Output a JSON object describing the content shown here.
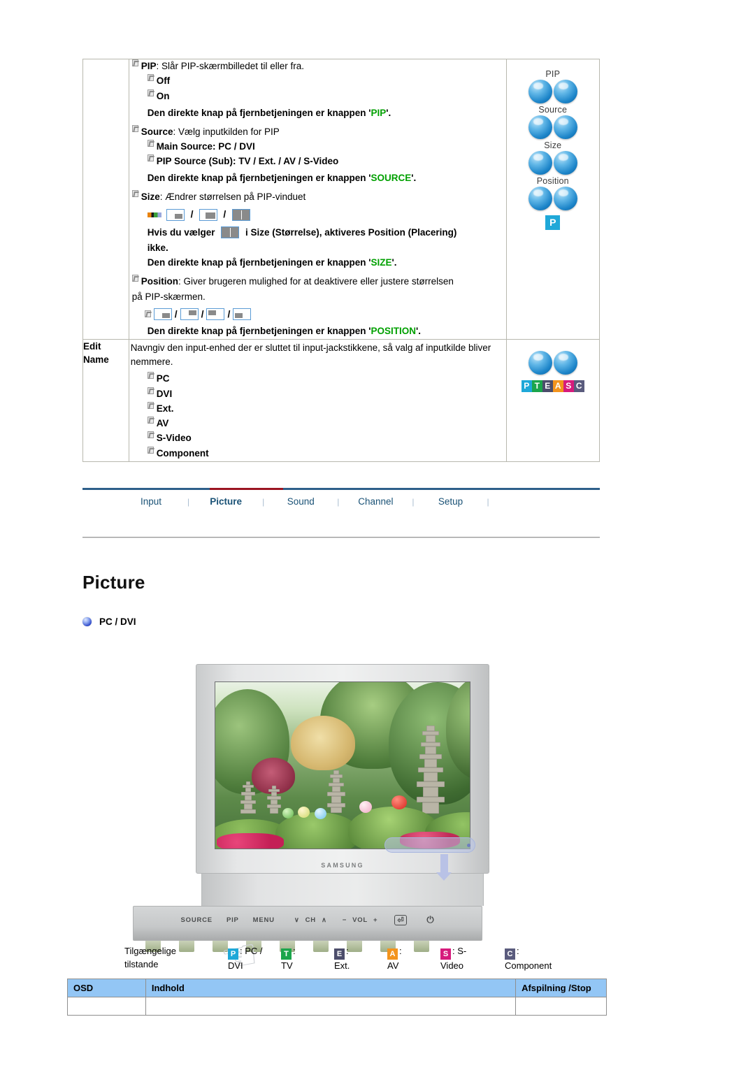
{
  "spec_table": {
    "rows": [
      {
        "label": "",
        "items": [
          {
            "title": "PIP",
            "desc": ": Slår PIP-skærmbilledet til eller fra.",
            "subs": [
              "Off",
              "On"
            ],
            "note_prefix": "Den direkte knap på fjernbetjeningen er knappen '",
            "note_key": "PIP",
            "note_suffix": "'."
          },
          {
            "title": "Source",
            "desc": ": Vælg inputkilden for PIP",
            "subs": [
              "Main Source: PC / DVI",
              "PIP Source (Sub): TV / Ext. / AV / S-Video"
            ],
            "note_prefix": "Den direkte knap på fjernbetjeningen er knappen '",
            "note_key": "SOURCE",
            "note_suffix": "'."
          },
          {
            "title": "Size",
            "desc": ": Ændrer størrelsen på PIP-vinduet",
            "icons_caption": "size-icons",
            "hint_a": "Hvis du vælger",
            "hint_b": "i Size (Størrelse), aktiveres Position (Placering)",
            "hint_c": "ikke.",
            "note_prefix": "Den direkte knap på fjernbetjeningen er knappen '",
            "note_key": "SIZE",
            "note_suffix": "'."
          },
          {
            "title": "Position",
            "desc": ": Giver brugeren mulighed for at deaktivere eller justere størrelsen",
            "desc2": "på PIP-skærmen.",
            "icons_caption": "position-icons",
            "note_prefix": "Den direkte knap på fjernbetjeningen er knappen '",
            "note_key": "POSITION",
            "note_suffix": "'."
          }
        ],
        "icon_column": {
          "groups": [
            {
              "caption": "PIP"
            },
            {
              "caption": "Source"
            },
            {
              "caption": "Size"
            },
            {
              "caption": "Position"
            }
          ],
          "badge": "P"
        }
      },
      {
        "label": "Edit\nName",
        "desc": "Navngiv den input-enhed der er sluttet til input-jackstikkene, så valg af inputkilde bliver nemmere.",
        "subs": [
          "PC",
          "DVI",
          "Ext.",
          "AV",
          "S-Video",
          "Component"
        ],
        "mode_strip": [
          {
            "letter": "P",
            "color": "#1fa8d8"
          },
          {
            "letter": "T",
            "color": "#1ba54b"
          },
          {
            "letter": "E",
            "color": "#4c4d6b"
          },
          {
            "letter": "A",
            "color": "#f3941d"
          },
          {
            "letter": "S",
            "color": "#d61b7c"
          },
          {
            "letter": "C",
            "color": "#5a5b7d"
          }
        ]
      }
    ]
  },
  "nav": {
    "items": [
      {
        "label": "Input",
        "active": false
      },
      {
        "label": "Picture",
        "active": true
      },
      {
        "label": "Sound",
        "active": false
      },
      {
        "label": "Channel",
        "active": false
      },
      {
        "label": "Setup",
        "active": false
      }
    ],
    "separator": "|",
    "active_color": "#9b1421",
    "line_color": "#2e5f8a"
  },
  "page": {
    "heading": "Picture",
    "subheading": "PC / DVI"
  },
  "monitor": {
    "brand": "SAMSUNG",
    "buttons": [
      "SOURCE",
      "PIP",
      "MENU",
      "∨",
      "CH",
      "∧",
      "−",
      "VOL",
      "+",
      "⏎",
      "⏻"
    ]
  },
  "legend": {
    "title_line1": "Tilgængelige",
    "title_line2": "tilstande",
    "items": [
      {
        "letter": "P",
        "color": "#1fa8d8",
        "text": ": PC /",
        "text2": "DVI"
      },
      {
        "letter": "T",
        "color": "#1ba54b",
        "text": ":",
        "text2": "TV"
      },
      {
        "letter": "E",
        "color": "#4c4d6b",
        "text": ":",
        "text2": "Ext."
      },
      {
        "letter": "A",
        "color": "#f3941d",
        "text": ":",
        "text2": "AV"
      },
      {
        "letter": "S",
        "color": "#d61b7c",
        "text": ": S-",
        "text2": "Video"
      },
      {
        "letter": "C",
        "color": "#5a5b7d",
        "text": ":",
        "text2": "Component"
      }
    ]
  },
  "osd_table": {
    "headers": [
      "OSD",
      "Indhold",
      "Afspilning /Stop"
    ],
    "rows": [
      [
        "",
        "",
        ""
      ]
    ]
  }
}
